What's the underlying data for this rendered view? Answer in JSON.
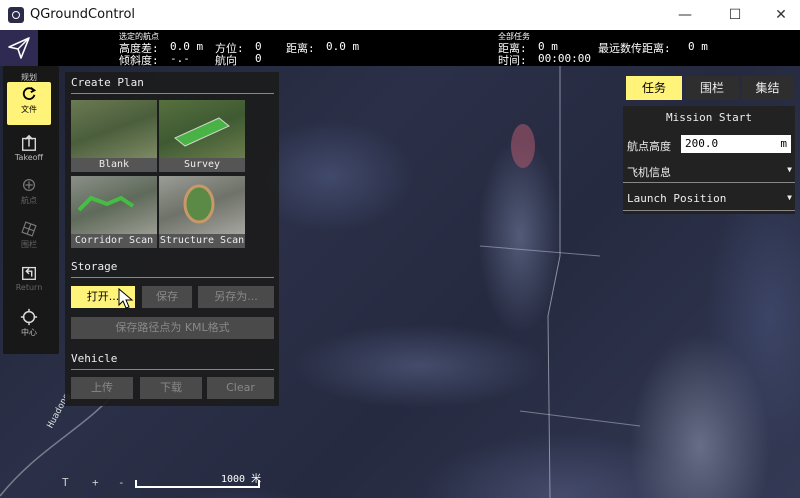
{
  "window": {
    "title": "QGroundControl",
    "controls": {
      "minimize": "—",
      "maximize": "☐",
      "close": "✕"
    }
  },
  "telemetry": {
    "selected_caption": "选定的航点",
    "alt_diff_label": "高度差:",
    "alt_diff_value": "0.0 m",
    "azimuth_label": "方位:",
    "azimuth_value": "0",
    "distance_label": "距离:",
    "distance_value": "0.0 m",
    "gradient_label": "倾斜度:",
    "gradient_value": "-.-",
    "heading_label": "航向",
    "heading_value": "0",
    "total_caption": "全部任务",
    "total_distance_label": "距离:",
    "total_distance_value": "0 m",
    "max_telem_label": "最远数传距离:",
    "max_telem_value": "0 m",
    "time_label": "时间:",
    "time_value": "00:00:00"
  },
  "toolstrip": {
    "items": [
      {
        "label": "规划",
        "icon": "plan-header"
      },
      {
        "label": "文件",
        "icon": "refresh-icon"
      },
      {
        "label": "Takeoff",
        "icon": "takeoff-icon"
      },
      {
        "label": "航点",
        "icon": "waypoint-icon"
      },
      {
        "label": "围栏",
        "icon": "fence-icon"
      },
      {
        "label": "Return",
        "icon": "return-icon"
      },
      {
        "label": "中心",
        "icon": "center-icon"
      }
    ]
  },
  "plan_panel": {
    "create_title": "Create Plan",
    "templates": [
      {
        "label": "Blank"
      },
      {
        "label": "Survey"
      },
      {
        "label": "Corridor Scan"
      },
      {
        "label": "Structure Scan"
      }
    ],
    "storage_title": "Storage",
    "open_label": "打开...",
    "save_label": "保存",
    "save_as_label": "另存为...",
    "save_kml_label": "保存路径点为 KML格式",
    "vehicle_title": "Vehicle",
    "upload_label": "上传",
    "download_label": "下载",
    "clear_label": "Clear"
  },
  "mission_panel": {
    "tabs": [
      "任务",
      "围栏",
      "集结"
    ],
    "active_tab": "任务",
    "mission_start": "Mission Start",
    "altitude_label": "航点高度",
    "altitude_value": "200.0",
    "altitude_unit": "m",
    "vehicle_info_label": "飞机信息",
    "launch_position_label": "Launch Position"
  },
  "map": {
    "road_label": "Huadong",
    "scale_text": "1000 米",
    "zoom_controls": [
      "T",
      "+",
      "-"
    ]
  },
  "colors": {
    "accent": "#fff37a",
    "panel": "#1c1c1c",
    "telemetry_bg": "#000000"
  }
}
